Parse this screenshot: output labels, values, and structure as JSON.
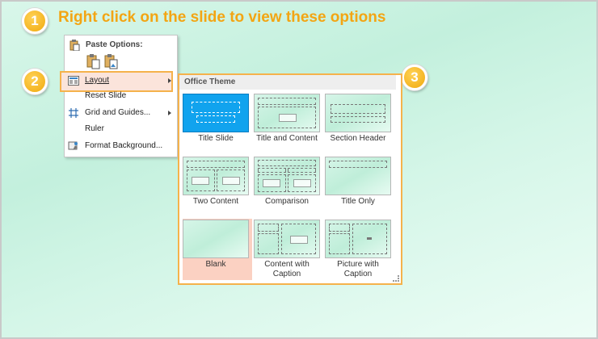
{
  "instruction": "Right click on the slide to view these options",
  "steps": [
    "1",
    "2",
    "3"
  ],
  "colors": {
    "accent_orange": "#f5b24b",
    "step_badge": "#f0a90e",
    "selected_thumb": "#11a3ee",
    "blank_highlight": "#fbd1c2",
    "layout_highlight": "#fbe4db"
  },
  "context_menu": {
    "paste_options": "Paste Options:",
    "items": [
      {
        "label": "Layout",
        "icon": "layout-icon",
        "submenu": true
      },
      {
        "label": "Reset Slide",
        "icon": "",
        "submenu": false
      },
      {
        "label": "Grid and Guides...",
        "icon": "grid-icon",
        "submenu": true
      },
      {
        "label": "Ruler",
        "icon": "",
        "submenu": false
      },
      {
        "label": "Format Background...",
        "icon": "format-background-icon",
        "submenu": false
      }
    ]
  },
  "layout_gallery": {
    "header": "Office Theme",
    "layouts": [
      {
        "name": "Title Slide",
        "selected": true
      },
      {
        "name": "Title and Content",
        "selected": false
      },
      {
        "name": "Section Header",
        "selected": false
      },
      {
        "name": "Two Content",
        "selected": false
      },
      {
        "name": "Comparison",
        "selected": false
      },
      {
        "name": "Title Only",
        "selected": false
      },
      {
        "name": "Blank",
        "selected": false,
        "highlighted": true
      },
      {
        "name": "Content with Caption",
        "selected": false
      },
      {
        "name": "Picture with Caption",
        "selected": false
      }
    ]
  }
}
